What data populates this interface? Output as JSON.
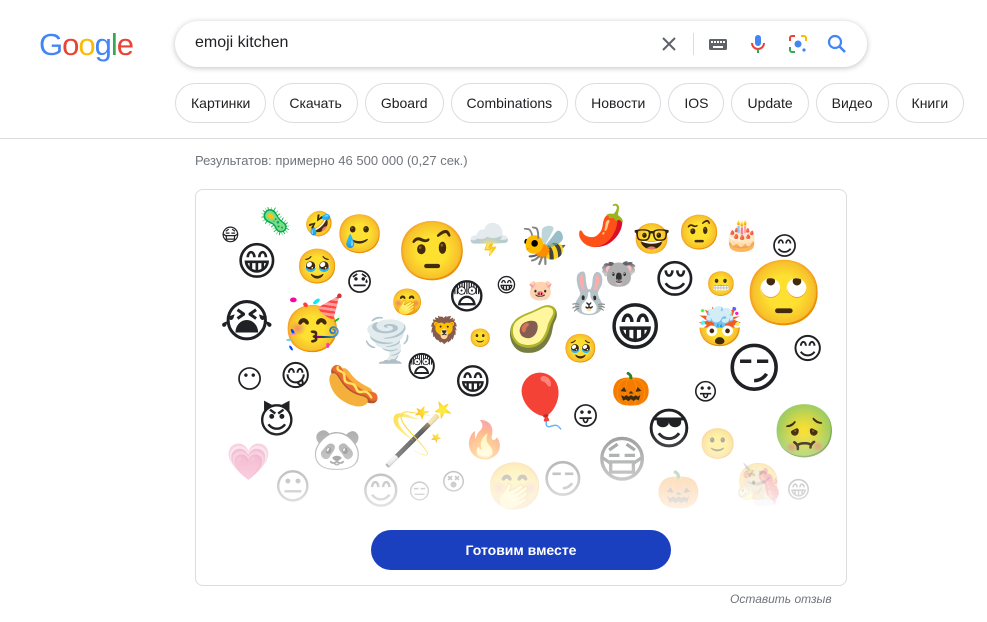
{
  "logo": {
    "text": "Google"
  },
  "search": {
    "query": "emoji kitchen"
  },
  "icons": {
    "clear": "close-icon",
    "keyboard": "keyboard-icon",
    "voice": "microphone-icon",
    "lens": "camera-lens-icon",
    "search": "search-icon"
  },
  "chips": [
    "Картинки",
    "Скачать",
    "Gboard",
    "Combinations",
    "Новости",
    "IOS",
    "Update",
    "Видео",
    "Книги"
  ],
  "results": {
    "count_text": "Результатов: примерно 46 500 000 (0,27 сек.)"
  },
  "card": {
    "button_label": "Готовим вместе",
    "emojis": [
      "😷",
      "🦠",
      "🤣",
      "🥲",
      "🤨",
      "🌩️",
      "🐝",
      "🌶️",
      "🤓",
      "🤨",
      "🎂",
      "😊",
      "😁",
      "🥹",
      "😓",
      "🤭",
      "😨",
      "😁",
      "🐷",
      "🐰",
      "🐨",
      "😌",
      "😬",
      "🙄",
      "😭",
      "🥳",
      "🌪️",
      "🦁",
      "🙂",
      "🥑",
      "🥹",
      "😁",
      "🤯",
      "😏",
      "😊",
      "😶",
      "😋",
      "🌭",
      "😨",
      "😁",
      "🎈",
      "🎃",
      "😛",
      "😊",
      "😈",
      "🪄",
      "😛",
      "😎",
      "🙂",
      "🤢",
      "💗",
      "🐼",
      "🔥",
      "😷",
      "🤗",
      "😐",
      "😊",
      "😑",
      "😵",
      "🤭",
      "😏",
      "🎃",
      "🦄",
      "😁"
    ]
  },
  "feedback": {
    "label": "Оставить отзыв"
  },
  "colors": {
    "brand_blue": "#1a3fbf",
    "google_blue": "#4285F4",
    "google_red": "#EA4335",
    "google_yellow": "#FBBC05",
    "google_green": "#34A853"
  }
}
